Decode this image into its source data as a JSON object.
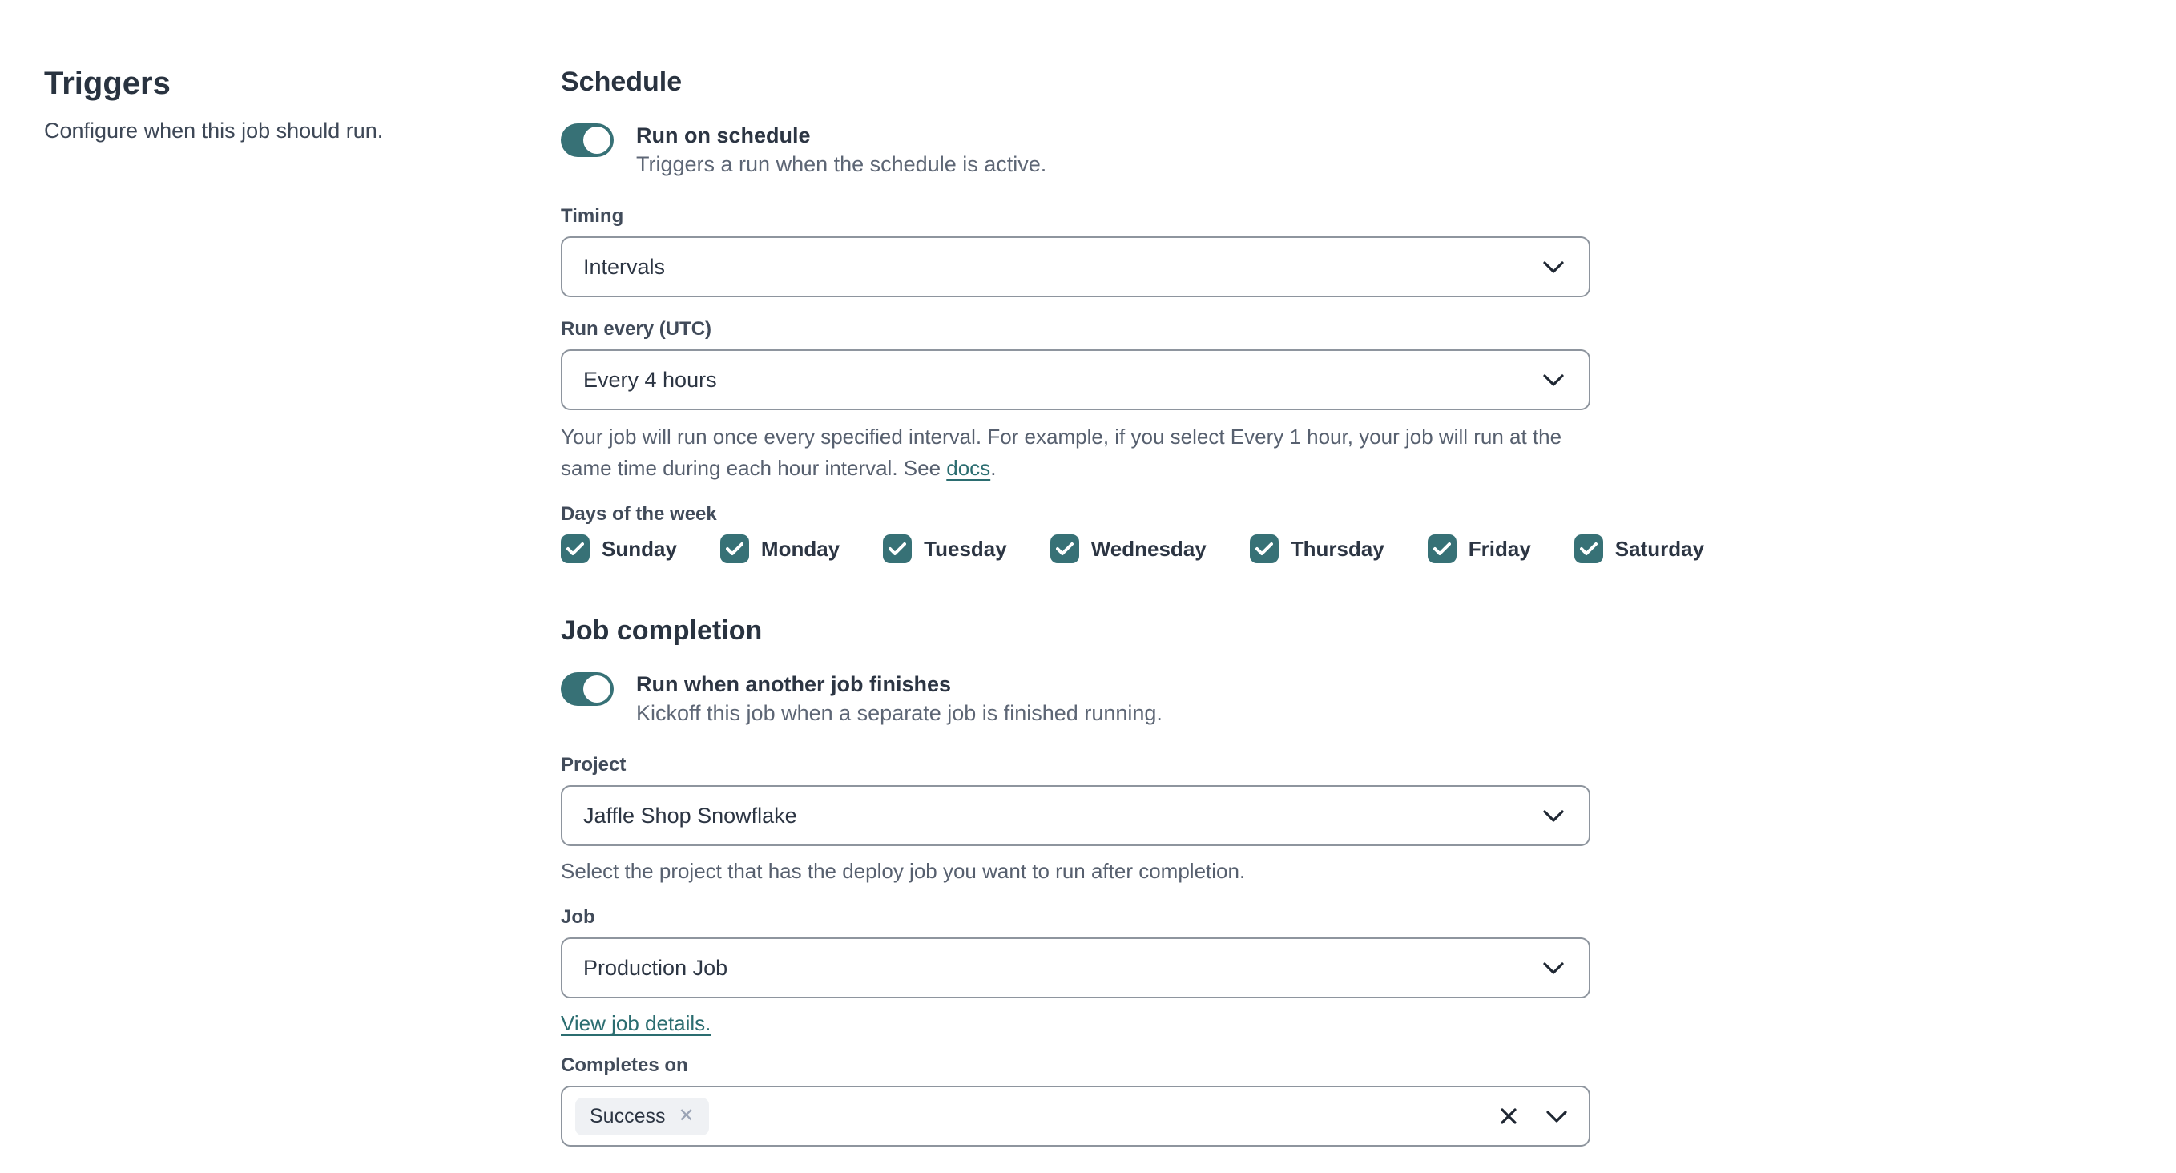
{
  "colors": {
    "accent_teal": "#377176",
    "link_teal": "#2b6d70",
    "heading_text": "#293340",
    "label_text": "#414b5a",
    "body_text": "#2c3543",
    "muted_text": "#5d6675",
    "field_border": "#8e959e",
    "chip_background": "#eff1f4",
    "page_background": "#ffffff"
  },
  "left_panel": {
    "title": "Triggers",
    "subtitle": "Configure when this job should run."
  },
  "schedule": {
    "heading": "Schedule",
    "run_on_schedule": {
      "label": "Run on schedule",
      "description": "Triggers a run when the schedule is active.",
      "enabled": true
    },
    "timing": {
      "label": "Timing",
      "value": "Intervals"
    },
    "run_every": {
      "label": "Run every (UTC)",
      "value": "Every 4 hours",
      "help_text": "Your job will run once every specified interval. For example, if you select Every 1 hour, your job will run at the same time during each hour interval. See ",
      "help_link_text": "docs",
      "help_suffix": "."
    },
    "days_of_week": {
      "label": "Days of the week",
      "items": [
        {
          "label": "Sunday",
          "checked": true
        },
        {
          "label": "Monday",
          "checked": true
        },
        {
          "label": "Tuesday",
          "checked": true
        },
        {
          "label": "Wednesday",
          "checked": true
        },
        {
          "label": "Thursday",
          "checked": true
        },
        {
          "label": "Friday",
          "checked": true
        },
        {
          "label": "Saturday",
          "checked": true
        }
      ]
    }
  },
  "job_completion": {
    "heading": "Job completion",
    "run_when_finishes": {
      "label": "Run when another job finishes",
      "description": "Kickoff this job when a separate job is finished running.",
      "enabled": true
    },
    "project": {
      "label": "Project",
      "value": "Jaffle Shop Snowflake",
      "help_text": "Select the project that has the deploy job you want to run after completion."
    },
    "job": {
      "label": "Job",
      "value": "Production Job",
      "link_text": "View job details."
    },
    "completes_on": {
      "label": "Completes on",
      "selected": [
        {
          "label": "Success"
        }
      ]
    }
  }
}
